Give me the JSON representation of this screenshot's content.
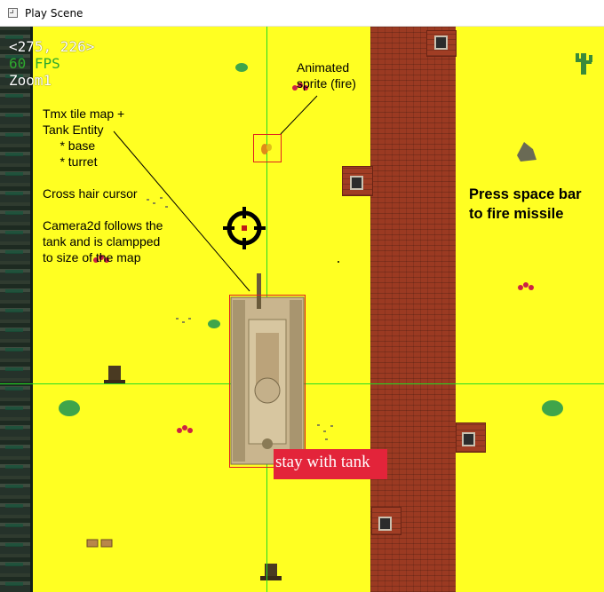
{
  "window": {
    "title": "Play Scene"
  },
  "hud": {
    "position": "<275, 226>",
    "fps": "60 FPS",
    "zoom": "Zoom1"
  },
  "annotations": {
    "animated_sprite": "Animated\nsprite (fire)",
    "tank_info": "Tmx tile map +\nTank Entity\n     * base\n     * turret\n\nCross hair cursor\n\nCamera2d follows the\ntank and is clampped\nto size of the map",
    "fire_hint": "Press space bar\nto fire missile",
    "stay_with_tank": "stay with tank"
  },
  "colors": {
    "sand": "#ffff22",
    "road": "#9b3a22",
    "guide_lines": "#22dd22",
    "bounding_box": "#e02020",
    "stay_banner": "#e3243a",
    "fps_text": "#2ea82e"
  }
}
